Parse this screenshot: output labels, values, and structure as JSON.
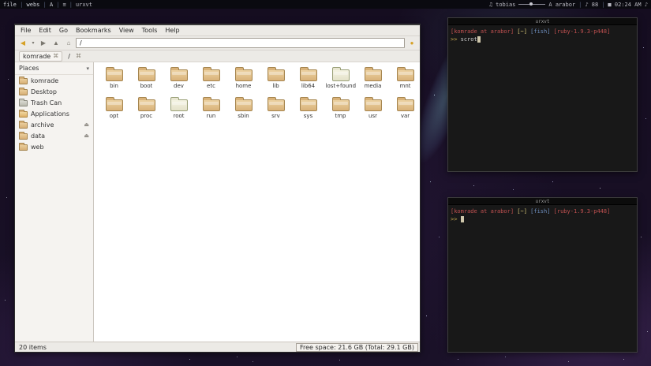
{
  "icons": {
    "back": "◀",
    "history_caret": "▾",
    "forward": "▶",
    "up": "▲",
    "home": "⌂",
    "go": "●",
    "eject": "⏏",
    "collapse": "▾",
    "tab": "⌘",
    "music": "♫"
  },
  "topbar": {
    "tags": [
      "file",
      "webs",
      "A"
    ],
    "layout_icon": "≡",
    "window_title": "urxvt",
    "right": {
      "user": "tobias",
      "host": "A arabor",
      "battery": "♪ 88",
      "time": "■ 02:24 AM ♪"
    }
  },
  "filemanager": {
    "menu": [
      "File",
      "Edit",
      "Go",
      "Bookmarks",
      "View",
      "Tools",
      "Help"
    ],
    "addressbar": {
      "value": "/"
    },
    "tabrow": {
      "tab_label": "komrade",
      "path_label": "/"
    },
    "places": {
      "title": "Places",
      "items": [
        {
          "label": "komrade",
          "icon": "folder",
          "eject": false
        },
        {
          "label": "Desktop",
          "icon": "folder",
          "eject": false
        },
        {
          "label": "Trash Can",
          "icon": "trash",
          "eject": false
        },
        {
          "label": "Applications",
          "icon": "apps",
          "eject": false
        },
        {
          "label": "archive",
          "icon": "folder",
          "eject": true
        },
        {
          "label": "data",
          "icon": "folder",
          "eject": true
        },
        {
          "label": "web",
          "icon": "folder",
          "eject": false
        }
      ]
    },
    "folders": [
      {
        "name": "bin",
        "variant": "tan"
      },
      {
        "name": "boot",
        "variant": "tan"
      },
      {
        "name": "dev",
        "variant": "tan"
      },
      {
        "name": "etc",
        "variant": "tan"
      },
      {
        "name": "home",
        "variant": "tan"
      },
      {
        "name": "lib",
        "variant": "tan"
      },
      {
        "name": "lib64",
        "variant": "tan"
      },
      {
        "name": "lost+found",
        "variant": "pale"
      },
      {
        "name": "media",
        "variant": "tan"
      },
      {
        "name": "mnt",
        "variant": "tan"
      },
      {
        "name": "opt",
        "variant": "tan"
      },
      {
        "name": "proc",
        "variant": "tan"
      },
      {
        "name": "root",
        "variant": "pale"
      },
      {
        "name": "run",
        "variant": "tan"
      },
      {
        "name": "sbin",
        "variant": "tan"
      },
      {
        "name": "srv",
        "variant": "tan"
      },
      {
        "name": "sys",
        "variant": "tan"
      },
      {
        "name": "tmp",
        "variant": "tan"
      },
      {
        "name": "usr",
        "variant": "tan"
      },
      {
        "name": "var",
        "variant": "tan"
      }
    ],
    "statusbar": {
      "items_count": "20 items",
      "free_space": "Free space: 21.6 GB (Total: 29.1 GB)"
    }
  },
  "terminals": [
    {
      "title": "urxvt",
      "prompt": [
        {
          "text": "[komrade at arabor]",
          "color": "#c05050"
        },
        {
          "text": " [~]",
          "color": "#d8c878"
        },
        {
          "text": " [fish]",
          "color": "#6e8fc0"
        },
        {
          "text": " [ruby-1.9.3-p448]",
          "color": "#c05050"
        }
      ],
      "input": [
        {
          "text": ">> ",
          "color": "#c8a84e"
        },
        {
          "text": "scrot",
          "color": "#cfcfcf"
        }
      ],
      "cursor": true
    },
    {
      "title": "urxvt",
      "prompt": [
        {
          "text": "[komrade at arabor]",
          "color": "#c05050"
        },
        {
          "text": " [~]",
          "color": "#d8c878"
        },
        {
          "text": " [fish]",
          "color": "#6e8fc0"
        },
        {
          "text": " [ruby-1.9.3-p448]",
          "color": "#c05050"
        }
      ],
      "input": [
        {
          "text": ">> ",
          "color": "#c8a84e"
        }
      ],
      "cursor": true
    }
  ]
}
